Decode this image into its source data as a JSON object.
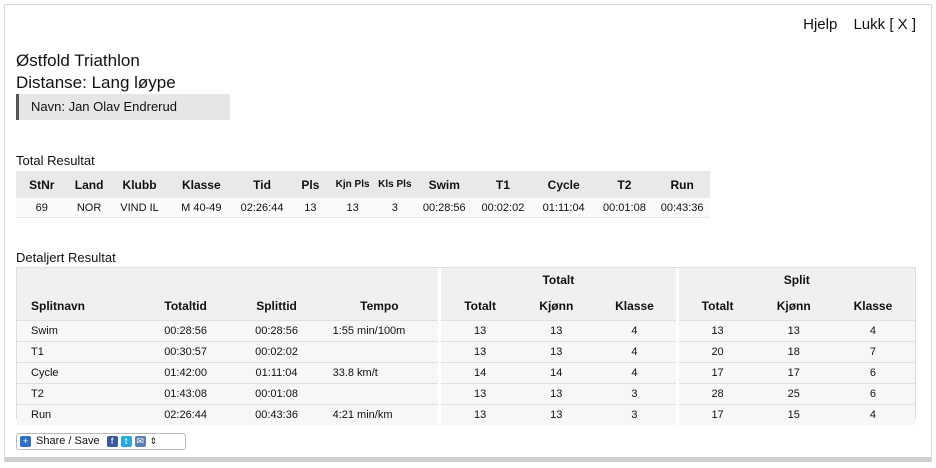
{
  "links": {
    "help": "Hjelp",
    "close": "Lukk [ X ]"
  },
  "event": {
    "name": "Østfold Triathlon",
    "distance": "Distanse: Lang løype",
    "athlete": "Navn: Jan Olav Endrerud"
  },
  "total_section": {
    "title": "Total Resultat",
    "headers": [
      "StNr",
      "Land",
      "Klubb",
      "Klasse",
      "Tid",
      "Pls",
      "Kjn Pls",
      "Kls Pls",
      "Swim",
      "T1",
      "Cycle",
      "T2",
      "Run"
    ],
    "row": [
      "69",
      "NOR",
      "VIND IL",
      "M 40-49",
      "02:26:44",
      "13",
      "13",
      "3",
      "00:28:56",
      "00:02:02",
      "01:11:04",
      "00:01:08",
      "00:43:36"
    ]
  },
  "detail_section": {
    "title": "Detaljert Resultat",
    "group_totalt": "Totalt",
    "group_split": "Split",
    "headers": [
      "Splitnavn",
      "Totaltid",
      "Splittid",
      "Tempo",
      "Totalt",
      "Kjønn",
      "Klasse",
      "Totalt",
      "Kjønn",
      "Klasse"
    ],
    "rows": [
      [
        "Swim",
        "00:28:56",
        "00:28:56",
        "1:55 min/100m",
        "13",
        "13",
        "4",
        "13",
        "13",
        "4"
      ],
      [
        "T1",
        "00:30:57",
        "00:02:02",
        "",
        "13",
        "13",
        "4",
        "20",
        "18",
        "7"
      ],
      [
        "Cycle",
        "01:42:00",
        "01:11:04",
        "33.8 km/t",
        "14",
        "14",
        "4",
        "17",
        "17",
        "6"
      ],
      [
        "T2",
        "01:43:08",
        "00:01:08",
        "",
        "13",
        "13",
        "3",
        "28",
        "25",
        "6"
      ],
      [
        "Run",
        "02:26:44",
        "00:43:36",
        "4:21 min/km",
        "13",
        "13",
        "3",
        "17",
        "15",
        "4"
      ]
    ]
  },
  "share": {
    "label": "Share / Save",
    "icons": [
      "share-icon",
      "facebook-icon",
      "twitter-icon",
      "email-icon",
      "updown-arrow-icon"
    ]
  }
}
